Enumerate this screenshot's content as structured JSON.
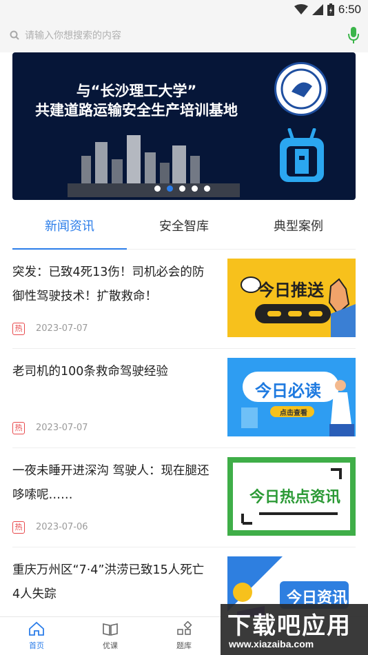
{
  "status": {
    "time": "6:50"
  },
  "search": {
    "placeholder": "请输入你想搜索的内容"
  },
  "banner": {
    "line1": "与“长沙理工大学”",
    "line2": "共建道路运输安全生产培训基地",
    "slide_count": 5,
    "active_slide": 1
  },
  "tabs": [
    {
      "label": "新闻资讯",
      "active": true
    },
    {
      "label": "安全智库",
      "active": false
    },
    {
      "label": "典型案例",
      "active": false
    }
  ],
  "news": [
    {
      "title": "突发：已致4死13伤！司机必会的防御性驾驶技术！扩散救命！",
      "badge": "热",
      "date": "2023-07-07",
      "thumb_text": "今日推送"
    },
    {
      "title": "老司机的100条救命驾驶经验",
      "badge": "热",
      "date": "2023-07-07",
      "thumb_text": "今日必读",
      "thumb_sub": "点击查看"
    },
    {
      "title": "一夜未睡开进深沟 驾驶人：现在腿还哆嗦呢……",
      "badge": "热",
      "date": "2023-07-06",
      "thumb_text": "今日热点资讯"
    },
    {
      "title": "重庆万州区“7·4”洪涝已致15人死亡 4人失踪",
      "thumb_text": "今日资讯"
    }
  ],
  "tabbar": [
    {
      "label": "首页",
      "icon": "home-icon",
      "active": true
    },
    {
      "label": "优课",
      "icon": "book-icon",
      "active": false
    },
    {
      "label": "题库",
      "icon": "grid-icon",
      "active": false
    }
  ],
  "watermark": {
    "main": "下载吧应用",
    "url": "www.xiazaiba.com"
  },
  "colors": {
    "accent": "#2b7de9",
    "hot": "#e8484b",
    "banner_bg": "#061638"
  }
}
